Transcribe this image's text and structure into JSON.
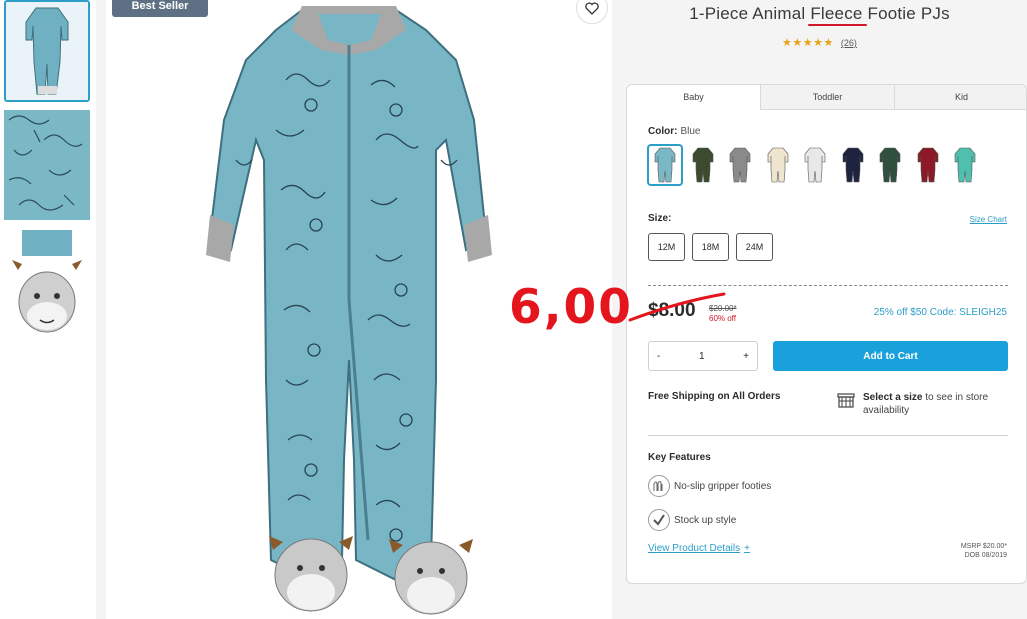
{
  "thumbnails": [
    {
      "icon": "onesie-full-thumbnail"
    },
    {
      "icon": "fabric-closeup-thumbnail"
    },
    {
      "icon": "footie-closeup-thumbnail"
    }
  ],
  "badge": "Best Seller",
  "product": {
    "title_before": "1-Piece Animal ",
    "title_highlight": "Fleece",
    "title_after": " Footie PJs",
    "stars": "★★★★★",
    "review_count": "(26)"
  },
  "tabs": [
    {
      "label": "Baby",
      "active": true
    },
    {
      "label": "Toddler",
      "active": false
    },
    {
      "label": "Kid",
      "active": false
    }
  ],
  "color": {
    "label": "Color:",
    "value": "Blue",
    "swatches": [
      "#7ab8c6",
      "#3c4a2e",
      "#8a8a8a",
      "#efe5cf",
      "#e8e8e8",
      "#1e2340",
      "#2f4f3f",
      "#8b1a26",
      "#4fbfae"
    ]
  },
  "size": {
    "label": "Size:",
    "chart_link": "Size Chart",
    "options": [
      "12M",
      "18M",
      "24M"
    ]
  },
  "pricing": {
    "price": "$8.00",
    "original": "$20.00*",
    "discount": "60% off",
    "promo": "25% off $50 Code: SLEIGH25"
  },
  "quantity": {
    "minus": "-",
    "value": "1",
    "plus": "+"
  },
  "cart_button": "Add to Cart",
  "shipping": "Free Shipping on All Orders",
  "store": {
    "bold": "Select a size",
    "rest": " to see in store availability"
  },
  "features": {
    "title": "Key Features",
    "items": [
      "No-slip gripper footies",
      "Stock up style"
    ]
  },
  "details_link": "View Product Details",
  "details_plus": "+",
  "msrp": {
    "line1": "MSRP $20.00*",
    "line2": "DOB 08/2019"
  },
  "annotation": "6,00",
  "colors": {
    "accent": "#2d9ec8",
    "cart": "#1aa1dc",
    "sale_red": "#d0182a",
    "annotation": "#e5151e"
  }
}
